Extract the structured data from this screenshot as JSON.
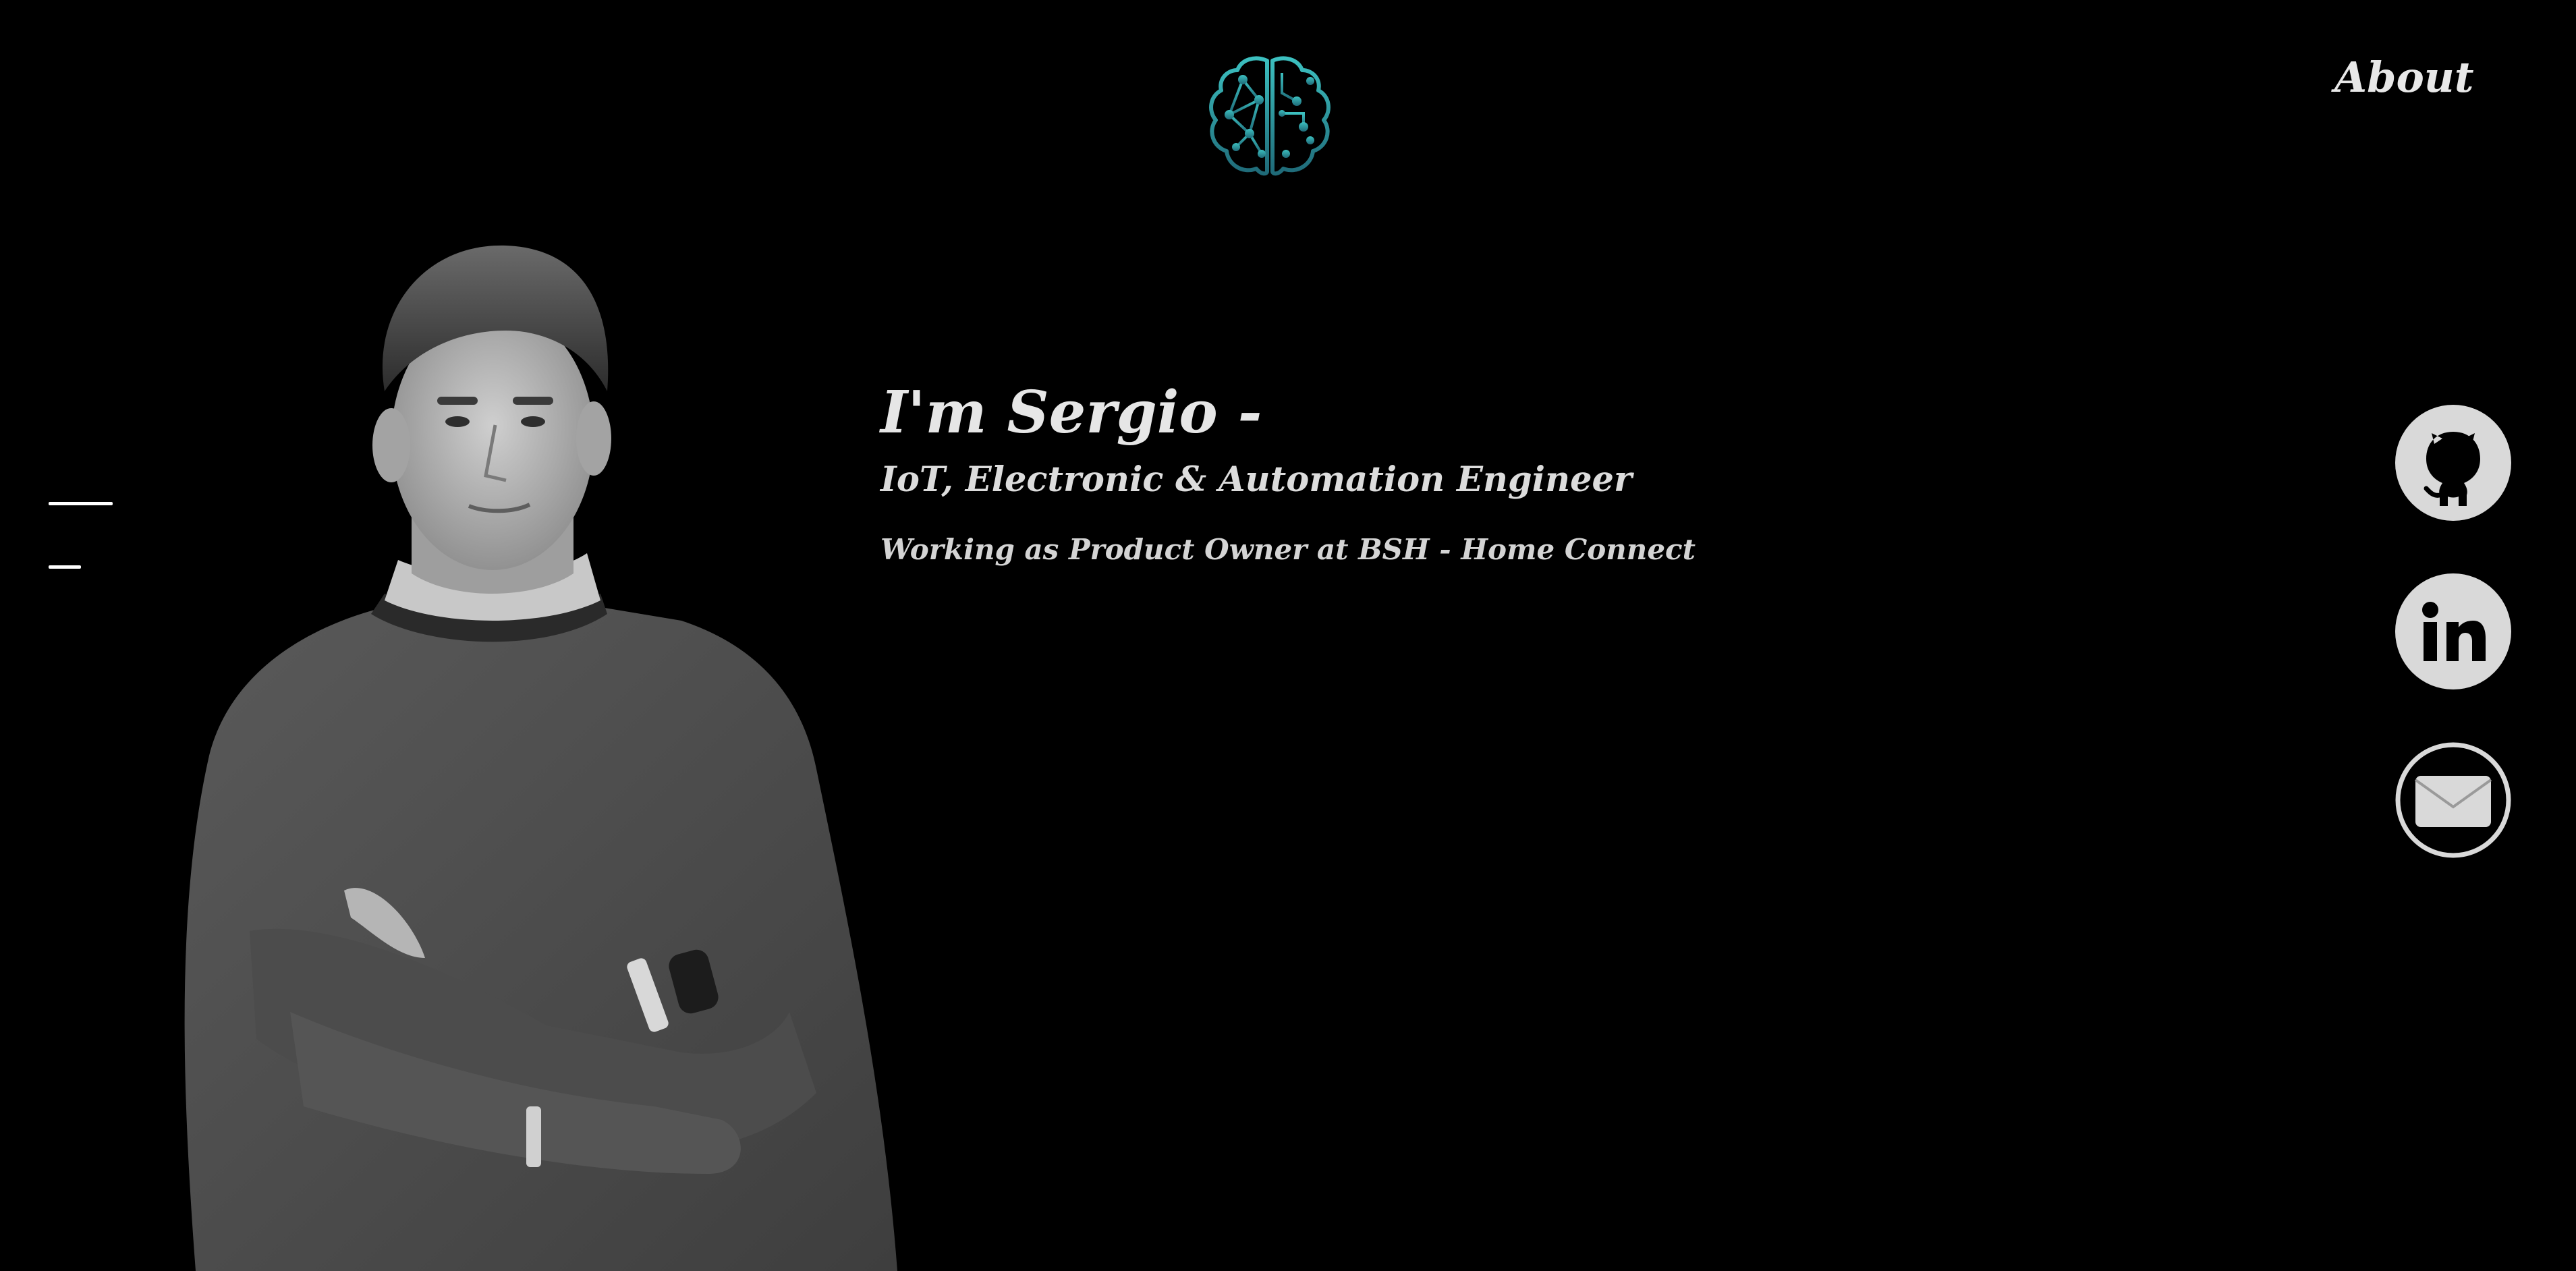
{
  "header": {
    "logo_icon": "brain-circuit-icon",
    "nav_about_label": "About"
  },
  "menu": {
    "toggle_icon": "hamburger-menu-icon"
  },
  "hero": {
    "title": "I'm Sergio -",
    "subtitle": "IoT, Electronic & Automation Engineer",
    "role": "Working as Product Owner at BSH - Home Connect"
  },
  "social": {
    "items": [
      {
        "name": "GitHub",
        "icon": "github-icon"
      },
      {
        "name": "LinkedIn",
        "icon": "linkedin-icon"
      },
      {
        "name": "Email",
        "icon": "mail-icon"
      }
    ]
  },
  "colors": {
    "background": "#000000",
    "text": "#e6e6e6",
    "logo_teal": "#2aa6a6",
    "logo_teal_dark": "#1d6f7a",
    "icon_bg": "#d9d9d9",
    "icon_fg": "#000000"
  }
}
